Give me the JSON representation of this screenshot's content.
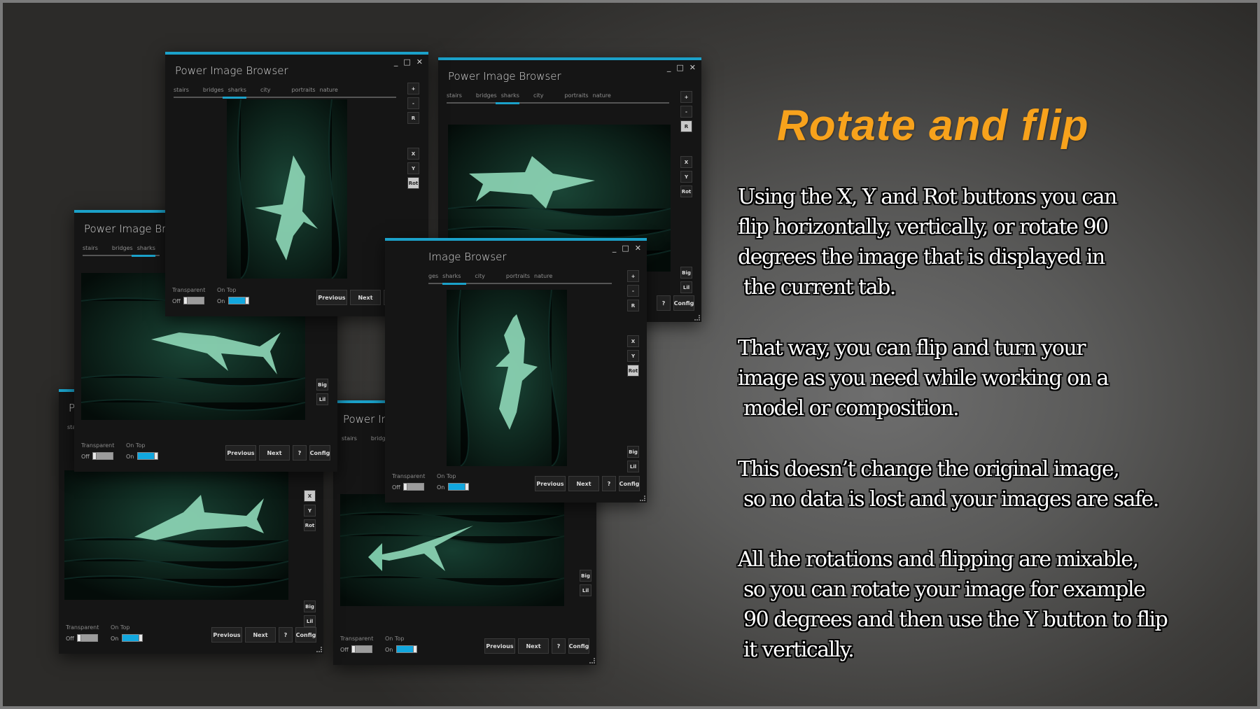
{
  "app": {
    "title": "Power Image Browser",
    "title_partial_a": "Power Image Bro",
    "title_partial_b": "Image Browser",
    "title_partial_c": "Power Im",
    "title_partial_d": "P",
    "window_controls": {
      "minimize": "_",
      "maximize": "□",
      "close": "✕"
    },
    "tabs": [
      "stairs",
      "bridges",
      "sharks",
      "city",
      "portraits",
      "nature"
    ],
    "tabs_partial_b": [
      "ges",
      "sharks",
      "city",
      "portraits",
      "nature"
    ],
    "tabs_partial_c": [
      "stairs",
      "bridges"
    ],
    "tabs_partial_d": [
      "sta"
    ],
    "active_tab": "sharks",
    "side_buttons": {
      "zoom_in": "+",
      "zoom_out": "-",
      "reset": "R",
      "flip_x": "X",
      "flip_y": "Y",
      "rotate": "Rot",
      "big": "Big",
      "little": "Lil"
    },
    "footer": {
      "transparent_label": "Transparent",
      "transparent_state": "Off",
      "on_top_label": "On Top",
      "on_top_state": "On",
      "previous": "Previous",
      "next": "Next",
      "help": "?",
      "config": "Config"
    },
    "accent_color": "#1ba1c9",
    "toggle_on_color": "#12a7de"
  },
  "windows": [
    {
      "id": "w1",
      "active_button": "Rot"
    },
    {
      "id": "w2",
      "active_button": "R"
    },
    {
      "id": "w3",
      "active_button": "Rot"
    },
    {
      "id": "w4",
      "active_button": "X"
    },
    {
      "id": "w5",
      "active_button": "Y"
    }
  ],
  "panel": {
    "heading": "Rotate and flip",
    "heading_color": "#f7a21c",
    "paragraphs": [
      [
        "Using the X, Y and Rot buttons you can",
        "flip horizontally, vertically, or rotate 90",
        "degrees the image that is displayed in",
        " the current tab."
      ],
      [
        "That way, you can flip and turn your",
        "image as you need while working on a",
        " model or composition."
      ],
      [
        "This doesn’t change the original image,",
        " so no data is lost and your images are safe."
      ],
      [
        "All the rotations and flipping are mixable,",
        " so you can rotate your image for example",
        " 90 degrees and then use the Y button to flip",
        " it vertically."
      ]
    ]
  }
}
